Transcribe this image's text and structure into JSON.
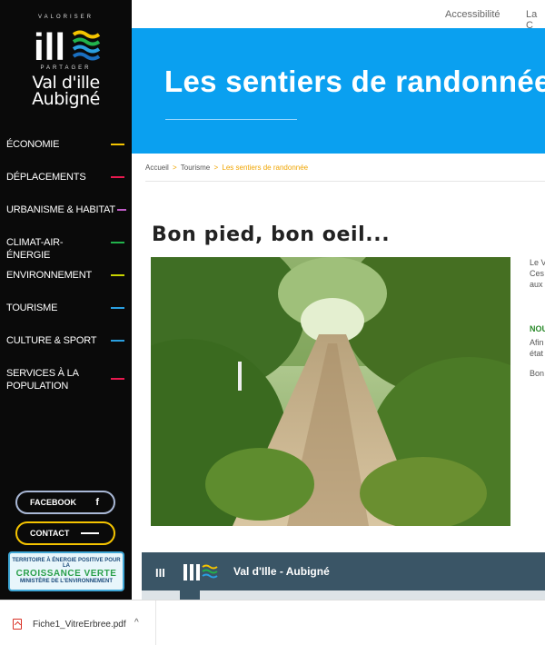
{
  "brand": {
    "tagline_top": "VALORISER",
    "tagline_bottom": "PARTAGER",
    "name_line1": "Val d'ille",
    "name_line2": "Aubigné",
    "mark_text": "ill"
  },
  "sidebar": {
    "items": [
      {
        "label": "Économie",
        "color": "#f5c400"
      },
      {
        "label": "Déplacements",
        "color": "#e8194f"
      },
      {
        "label": "Urbanisme & Habitat",
        "color": "#c05cc8"
      },
      {
        "label": "Climat-Air-Énergie",
        "color": "#22b24c"
      },
      {
        "label": "Environnement",
        "color": "#c8d400"
      },
      {
        "label": "Tourisme",
        "color": "#2a9fe0"
      },
      {
        "label": "Culture & Sport",
        "color": "#2a9fe0"
      },
      {
        "label": "Services à la population",
        "color": "#e8194f"
      }
    ],
    "facebook_label": "FACEBOOK",
    "facebook_icon": "f",
    "contact_label": "CONTACT",
    "badge": {
      "line1": "TERRITOIRE À ÉNERGIE POSITIVE POUR LA",
      "line2": "CROISSANCE VERTE",
      "line3": "MINISTÈRE DE L'ENVIRONNEMENT"
    }
  },
  "topbar": {
    "accessibility": "Accessibilité",
    "more": "La C"
  },
  "banner": {
    "title": "Les sentiers de randonnée"
  },
  "breadcrumb": {
    "home": "Accueil",
    "parent": "Tourisme",
    "current": "Les sentiers de randonnée",
    "sep": ">"
  },
  "page": {
    "heading": "Bon pied, bon oeil..."
  },
  "side_text": {
    "l1": "Le V",
    "l2": "Ces",
    "l3": "aux",
    "l4": "NOU",
    "l5": "Afin",
    "l6": "état",
    "l7": "Bon"
  },
  "map": {
    "menu_icon": "III",
    "title": "Val d'Ille - Aubigné"
  },
  "download": {
    "filename": "Fiche1_VitreErbree.pdf",
    "caret": "^"
  }
}
